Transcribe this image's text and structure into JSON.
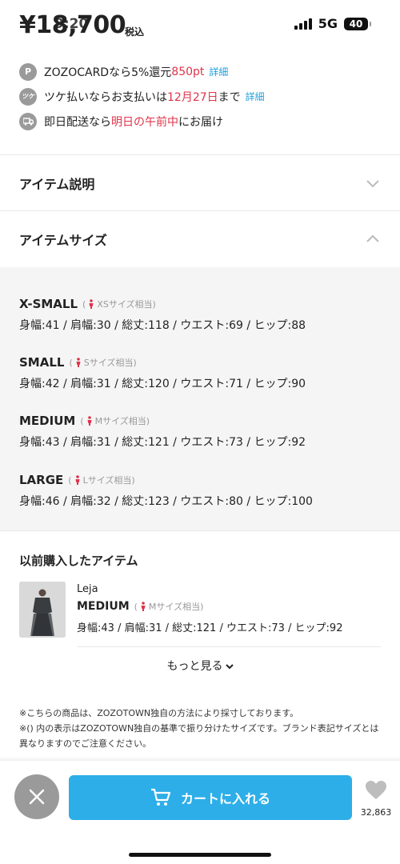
{
  "status_bar": {
    "time": "9:20",
    "network": "5G",
    "battery": "40"
  },
  "price": {
    "amount": "¥18,700",
    "tax_label": "税込"
  },
  "info_rows": [
    {
      "icon": "zozocard-icon",
      "icon_text": "P",
      "text_before": "ZOZOCARDなら5%還元 ",
      "highlight": "850pt",
      "text_after": "",
      "link": "詳細"
    },
    {
      "icon": "tsuke-icon",
      "icon_text": "ツケ",
      "text_before": "ツケ払いならお支払いは",
      "highlight": "12月27日",
      "text_after": "まで",
      "link": "詳細"
    },
    {
      "icon": "delivery-truck-icon",
      "icon_text": "",
      "text_before": "即日配送なら",
      "highlight": "明日の午前中",
      "text_after": "にお届け",
      "link": ""
    }
  ],
  "accordions": {
    "description": {
      "title": "アイテム説明"
    },
    "size": {
      "title": "アイテムサイズ"
    }
  },
  "sizes": [
    {
      "name": "X-SMALL",
      "equiv": "XSサイズ相当",
      "dims": "身幅:41 / 肩幅:30 / 総丈:118 / ウエスト:69 / ヒップ:88"
    },
    {
      "name": "SMALL",
      "equiv": "Sサイズ相当",
      "dims": "身幅:42 / 肩幅:31 / 総丈:120 / ウエスト:71 / ヒップ:90"
    },
    {
      "name": "MEDIUM",
      "equiv": "Mサイズ相当",
      "dims": "身幅:43 / 肩幅:31 / 総丈:121 / ウエスト:73 / ヒップ:92"
    },
    {
      "name": "LARGE",
      "equiv": "Lサイズ相当",
      "dims": "身幅:46 / 肩幅:32 / 総丈:123 / ウエスト:80 / ヒップ:100"
    }
  ],
  "previous": {
    "title": "以前購入したアイテム",
    "brand": "Leja",
    "size_name": "MEDIUM",
    "size_equiv": "Mサイズ相当",
    "dims": "身幅:43 / 肩幅:31 / 総丈:121 / ウエスト:73 / ヒップ:92",
    "see_more": "もっと見る"
  },
  "notes": [
    "※こちらの商品は、ZOZOTOWN独自の方法により採寸しております。",
    "※() 内の表示はZOZOTOWN独自の基準で振り分けたサイズです。ブランド表記サイズとは異なりますのでご注意ください。"
  ],
  "bottom_bar": {
    "cart_label": "カートに入れる",
    "favorite_count": "32,863"
  },
  "colors": {
    "accent_blue": "#2daee8",
    "highlight_red": "#e0334a",
    "link_blue": "#1ea0dd",
    "panel_gray": "#f5f5f5"
  }
}
